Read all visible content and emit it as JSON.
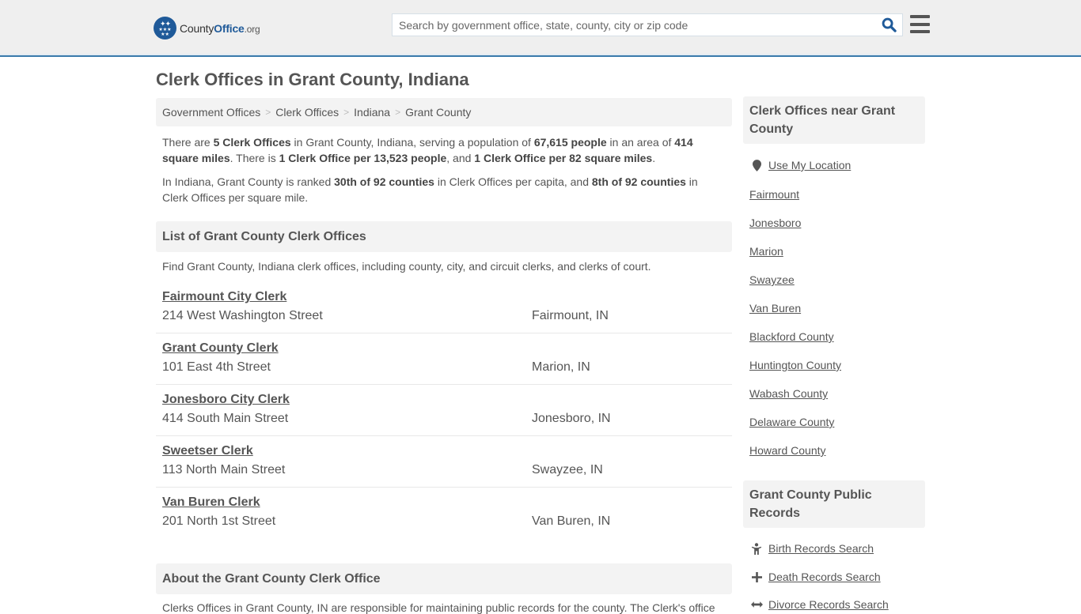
{
  "header": {
    "logo": {
      "name_part1": "County",
      "name_part2": "Office",
      "name_part3": ".org",
      "icon": "eagle-stars-badge"
    },
    "search": {
      "placeholder": "Search by government office, state, county, city or zip code",
      "value": "",
      "icon": "search-icon"
    },
    "menu_icon": "hamburger-menu-icon",
    "accent_color": "#3a7aab",
    "brand_color": "#1f5a99"
  },
  "page": {
    "title": "Clerk Offices in Grant County, Indiana"
  },
  "breadcrumb": [
    {
      "label": "Government Offices"
    },
    {
      "label": "Clerk Offices"
    },
    {
      "label": "Indiana"
    },
    {
      "label": "Grant County"
    }
  ],
  "intro": {
    "p1": {
      "t1": "There are ",
      "b1": "5 Clerk Offices",
      "t2": " in Grant County, Indiana, serving a population of ",
      "b2": "67,615 people",
      "t3": " in an area of ",
      "b3": "414 square miles",
      "t4": ". There is ",
      "b4": "1 Clerk Office per 13,523 people",
      "t5": ", and ",
      "b5": "1 Clerk Office per 82 square miles",
      "t6": "."
    },
    "p2": {
      "t1": "In Indiana, Grant County is ranked ",
      "b1": "30th of 92 counties",
      "t2": " in Clerk Offices per capita, and ",
      "b2": "8th of 92 counties",
      "t3": " in Clerk Offices per square mile."
    }
  },
  "list": {
    "heading": "List of Grant County Clerk Offices",
    "description": "Find Grant County, Indiana clerk offices, including county, city, and circuit clerks, and clerks of court.",
    "offices": [
      {
        "name": "Fairmount City Clerk",
        "address": "214 West Washington Street",
        "city": "Fairmount, IN"
      },
      {
        "name": "Grant County Clerk",
        "address": "101 East 4th Street",
        "city": "Marion, IN"
      },
      {
        "name": "Jonesboro City Clerk",
        "address": "414 South Main Street",
        "city": "Jonesboro, IN"
      },
      {
        "name": "Sweetser Clerk",
        "address": "113 North Main Street",
        "city": "Swayzee, IN"
      },
      {
        "name": "Van Buren Clerk",
        "address": "201 North 1st Street",
        "city": "Van Buren, IN"
      }
    ]
  },
  "about": {
    "heading": "About the Grant County Clerk Office",
    "text": "Clerks Offices in Grant County, IN are responsible for maintaining public records for the county. The Clerk's office"
  },
  "sidebar": {
    "nearby": {
      "heading": "Clerk Offices near Grant County",
      "use_location": {
        "label": "Use My Location",
        "icon": "map-marker-icon"
      },
      "links": [
        {
          "label": "Fairmount"
        },
        {
          "label": "Jonesboro"
        },
        {
          "label": "Marion"
        },
        {
          "label": "Swayzee"
        },
        {
          "label": "Van Buren"
        },
        {
          "label": "Blackford County"
        },
        {
          "label": "Huntington County"
        },
        {
          "label": "Wabash County"
        },
        {
          "label": "Delaware County"
        },
        {
          "label": "Howard County"
        }
      ]
    },
    "records": {
      "heading": "Grant County Public Records",
      "links": [
        {
          "label": "Birth Records Search",
          "icon": "child-icon"
        },
        {
          "label": "Death Records Search",
          "icon": "cross-icon"
        },
        {
          "label": "Divorce Records Search",
          "icon": "arrows-horizontal-icon"
        }
      ]
    }
  }
}
